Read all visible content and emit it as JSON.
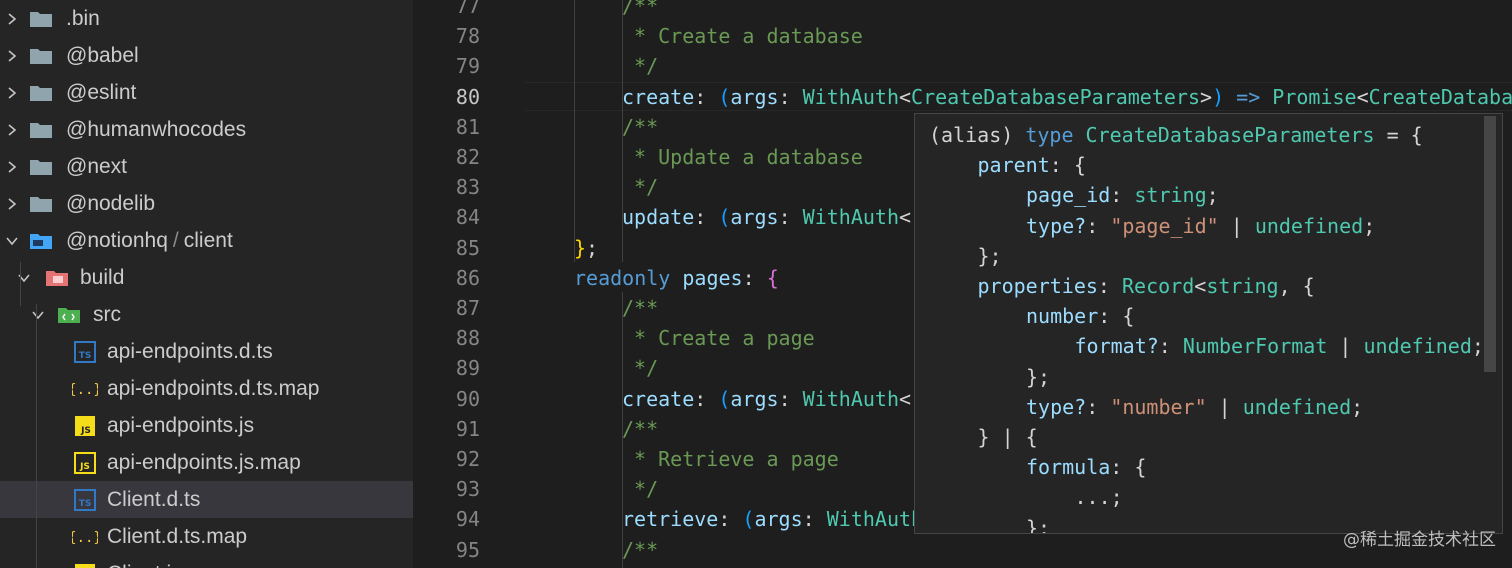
{
  "sidebar": {
    "items": [
      {
        "label": ".bin",
        "kind": "folder",
        "expanded": false,
        "depth": 0
      },
      {
        "label": "@babel",
        "kind": "folder",
        "expanded": false,
        "depth": 0
      },
      {
        "label": "@eslint",
        "kind": "folder",
        "expanded": false,
        "depth": 0
      },
      {
        "label": "@humanwhocodes",
        "kind": "folder",
        "expanded": false,
        "depth": 0
      },
      {
        "label": "@next",
        "kind": "folder",
        "expanded": false,
        "depth": 0
      },
      {
        "label": "@nodelib",
        "kind": "folder",
        "expanded": false,
        "depth": 0
      },
      {
        "label": "@notionhq",
        "label_suffix": "client",
        "label_separator": "/",
        "kind": "folder-open",
        "expanded": true,
        "depth": 0
      },
      {
        "label": "build",
        "kind": "folder-build",
        "expanded": true,
        "depth": 1
      },
      {
        "label": "src",
        "kind": "folder-src",
        "expanded": true,
        "depth": 2
      },
      {
        "label": "api-endpoints.d.ts",
        "kind": "ts",
        "badge": "TS",
        "depth": 3
      },
      {
        "label": "api-endpoints.d.ts.map",
        "kind": "map",
        "badge": "{..}",
        "depth": 3
      },
      {
        "label": "api-endpoints.js",
        "kind": "js",
        "badge": "JS",
        "depth": 3
      },
      {
        "label": "api-endpoints.js.map",
        "kind": "jsmap",
        "badge": "JS",
        "depth": 3
      },
      {
        "label": "Client.d.ts",
        "kind": "ts",
        "badge": "TS",
        "depth": 3,
        "selected": true
      },
      {
        "label": "Client.d.ts.map",
        "kind": "map",
        "badge": "{..}",
        "depth": 3
      },
      {
        "label": "Client.js",
        "kind": "js",
        "badge": "JS",
        "depth": 3
      }
    ]
  },
  "editor": {
    "active_line": "80",
    "lines": [
      {
        "n": "77",
        "indent": 2,
        "tokens": [
          [
            "c-com",
            "/**"
          ]
        ]
      },
      {
        "n": "78",
        "indent": 2,
        "tokens": [
          [
            "c-com",
            " * Create a database"
          ]
        ]
      },
      {
        "n": "79",
        "indent": 2,
        "tokens": [
          [
            "c-com",
            " */"
          ]
        ]
      },
      {
        "n": "80",
        "indent": 2,
        "tokens": [
          [
            "c-prop",
            "create"
          ],
          [
            "c-punc",
            ": "
          ],
          [
            "c-paren",
            "("
          ],
          [
            "c-prop",
            "args"
          ],
          [
            "c-punc",
            ": "
          ],
          [
            "c-type",
            "WithAuth"
          ],
          [
            "c-punc",
            "<"
          ],
          [
            "c-type",
            "CreateDatabaseParameters"
          ],
          [
            "c-punc",
            ">"
          ],
          [
            "c-paren",
            ")"
          ],
          [
            "c-kw",
            " => "
          ],
          [
            "c-type",
            "Promise"
          ],
          [
            "c-punc",
            "<"
          ],
          [
            "c-type",
            "CreateDatabaseResponse"
          ]
        ]
      },
      {
        "n": "81",
        "indent": 2,
        "tokens": [
          [
            "c-com",
            "/**"
          ]
        ]
      },
      {
        "n": "82",
        "indent": 2,
        "tokens": [
          [
            "c-com",
            " * Update a database"
          ]
        ]
      },
      {
        "n": "83",
        "indent": 2,
        "tokens": [
          [
            "c-com",
            " */"
          ]
        ]
      },
      {
        "n": "84",
        "indent": 2,
        "tokens": [
          [
            "c-prop",
            "update"
          ],
          [
            "c-punc",
            ": "
          ],
          [
            "c-paren",
            "("
          ],
          [
            "c-prop",
            "args"
          ],
          [
            "c-punc",
            ": "
          ],
          [
            "c-type",
            "WithAuth"
          ],
          [
            "c-punc",
            "<"
          ]
        ]
      },
      {
        "n": "85",
        "indent": 1,
        "tokens": [
          [
            "c-brace2",
            "}"
          ],
          [
            "c-punc",
            ";"
          ]
        ]
      },
      {
        "n": "86",
        "indent": 1,
        "tokens": [
          [
            "c-kw",
            "readonly "
          ],
          [
            "c-prop",
            "pages"
          ],
          [
            "c-punc",
            ": "
          ],
          [
            "c-brace",
            "{"
          ]
        ]
      },
      {
        "n": "87",
        "indent": 2,
        "tokens": [
          [
            "c-com",
            "/**"
          ]
        ]
      },
      {
        "n": "88",
        "indent": 2,
        "tokens": [
          [
            "c-com",
            " * Create a page"
          ]
        ]
      },
      {
        "n": "89",
        "indent": 2,
        "tokens": [
          [
            "c-com",
            " */"
          ]
        ]
      },
      {
        "n": "90",
        "indent": 2,
        "tokens": [
          [
            "c-prop",
            "create"
          ],
          [
            "c-punc",
            ": "
          ],
          [
            "c-paren",
            "("
          ],
          [
            "c-prop",
            "args"
          ],
          [
            "c-punc",
            ": "
          ],
          [
            "c-type",
            "WithAuth"
          ],
          [
            "c-punc",
            "<"
          ]
        ]
      },
      {
        "n": "91",
        "indent": 2,
        "tokens": [
          [
            "c-com",
            "/**"
          ]
        ]
      },
      {
        "n": "92",
        "indent": 2,
        "tokens": [
          [
            "c-com",
            " * Retrieve a page"
          ]
        ]
      },
      {
        "n": "93",
        "indent": 2,
        "tokens": [
          [
            "c-com",
            " */"
          ]
        ]
      },
      {
        "n": "94",
        "indent": 2,
        "tokens": [
          [
            "c-prop",
            "retrieve"
          ],
          [
            "c-punc",
            ": "
          ],
          [
            "c-paren",
            "("
          ],
          [
            "c-prop",
            "args"
          ],
          [
            "c-punc",
            ": "
          ],
          [
            "c-type",
            "WithAuth"
          ]
        ]
      },
      {
        "n": "95",
        "indent": 2,
        "tokens": [
          [
            "c-com",
            "/**"
          ]
        ]
      }
    ]
  },
  "hover": {
    "lines": [
      {
        "indent": 0,
        "tokens": [
          [
            "c-punc",
            "(alias) "
          ],
          [
            "c-kw",
            "type "
          ],
          [
            "c-type",
            "CreateDatabaseParameters"
          ],
          [
            "c-punc",
            " = {"
          ]
        ]
      },
      {
        "indent": 1,
        "tokens": [
          [
            "c-prop",
            "parent"
          ],
          [
            "c-punc",
            ": {"
          ]
        ]
      },
      {
        "indent": 2,
        "tokens": [
          [
            "c-prop",
            "page_id"
          ],
          [
            "c-punc",
            ": "
          ],
          [
            "c-type",
            "string"
          ],
          [
            "c-punc",
            ";"
          ]
        ]
      },
      {
        "indent": 2,
        "tokens": [
          [
            "c-prop",
            "type?"
          ],
          [
            "c-punc",
            ": "
          ],
          [
            "c-str",
            "\"page_id\""
          ],
          [
            "c-punc",
            " | "
          ],
          [
            "c-type",
            "undefined"
          ],
          [
            "c-punc",
            ";"
          ]
        ]
      },
      {
        "indent": 1,
        "tokens": [
          [
            "c-punc",
            "};"
          ]
        ]
      },
      {
        "indent": 1,
        "tokens": [
          [
            "c-prop",
            "properties"
          ],
          [
            "c-punc",
            ": "
          ],
          [
            "c-type",
            "Record"
          ],
          [
            "c-punc",
            "<"
          ],
          [
            "c-type",
            "string"
          ],
          [
            "c-punc",
            ", {"
          ]
        ]
      },
      {
        "indent": 2,
        "tokens": [
          [
            "c-prop",
            "number"
          ],
          [
            "c-punc",
            ": {"
          ]
        ]
      },
      {
        "indent": 3,
        "tokens": [
          [
            "c-prop",
            "format?"
          ],
          [
            "c-punc",
            ": "
          ],
          [
            "c-type",
            "NumberFormat"
          ],
          [
            "c-punc",
            " | "
          ],
          [
            "c-type",
            "undefined"
          ],
          [
            "c-punc",
            ";"
          ]
        ]
      },
      {
        "indent": 2,
        "tokens": [
          [
            "c-punc",
            "};"
          ]
        ]
      },
      {
        "indent": 2,
        "tokens": [
          [
            "c-prop",
            "type?"
          ],
          [
            "c-punc",
            ": "
          ],
          [
            "c-str",
            "\"number\""
          ],
          [
            "c-punc",
            " | "
          ],
          [
            "c-type",
            "undefined"
          ],
          [
            "c-punc",
            ";"
          ]
        ]
      },
      {
        "indent": 1,
        "tokens": [
          [
            "c-punc",
            "} | {"
          ]
        ]
      },
      {
        "indent": 2,
        "tokens": [
          [
            "c-prop",
            "formula"
          ],
          [
            "c-punc",
            ": {"
          ]
        ]
      },
      {
        "indent": 3,
        "tokens": [
          [
            "c-punc",
            "...;"
          ]
        ]
      },
      {
        "indent": 2,
        "tokens": [
          [
            "c-punc",
            "};"
          ]
        ]
      }
    ]
  },
  "watermark": "@稀土掘金技术社区",
  "colors": {
    "folder": "#90a4ae",
    "folder_open": "#42a5f5",
    "folder_build": "#e57373",
    "folder_src": "#4caf50",
    "ts": "#3178c6",
    "js": "#f5de19",
    "map": "#f5c542"
  }
}
